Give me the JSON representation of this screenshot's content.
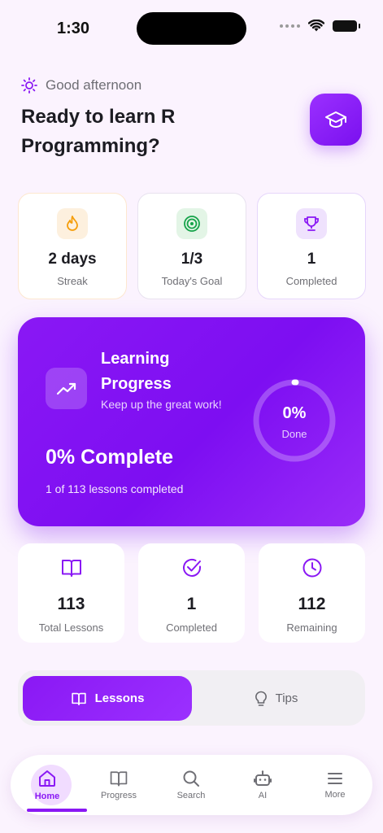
{
  "status_bar": {
    "time": "1:30"
  },
  "header": {
    "greeting": "Good afternoon",
    "title": "Ready to learn R Programming?",
    "action_icon": "graduation-cap-icon"
  },
  "stats": [
    {
      "value": "2 days",
      "label": "Streak",
      "icon": "flame-icon",
      "color": "#f59e0b"
    },
    {
      "value": "1/3",
      "label": "Today's Goal",
      "icon": "target-icon",
      "color": "#16a34a"
    },
    {
      "value": "1",
      "label": "Completed",
      "icon": "trophy-icon",
      "color": "#8a18f4"
    }
  ],
  "progress_card": {
    "title": "Learning Progress",
    "subtitle": "Keep up the great work!",
    "percent_text": "0% Complete",
    "lessons_text": "1 of 113 lessons completed",
    "ring_value": "0%",
    "ring_label": "Done",
    "progress_fraction": 0
  },
  "summary": [
    {
      "value": "113",
      "label": "Total Lessons",
      "icon": "book-icon"
    },
    {
      "value": "1",
      "label": "Completed",
      "icon": "check-circle-icon"
    },
    {
      "value": "112",
      "label": "Remaining",
      "icon": "clock-icon"
    }
  ],
  "tabs": {
    "active": "Lessons",
    "inactive": "Tips"
  },
  "bottom_nav": [
    {
      "label": "Home",
      "icon": "home-icon",
      "active": true
    },
    {
      "label": "Progress",
      "icon": "book-icon"
    },
    {
      "label": "Search",
      "icon": "search-icon"
    },
    {
      "label": "AI",
      "icon": "robot-icon"
    },
    {
      "label": "More",
      "icon": "menu-icon"
    }
  ],
  "colors": {
    "accent": "#8a18f4",
    "background": "#fbf3fe"
  }
}
